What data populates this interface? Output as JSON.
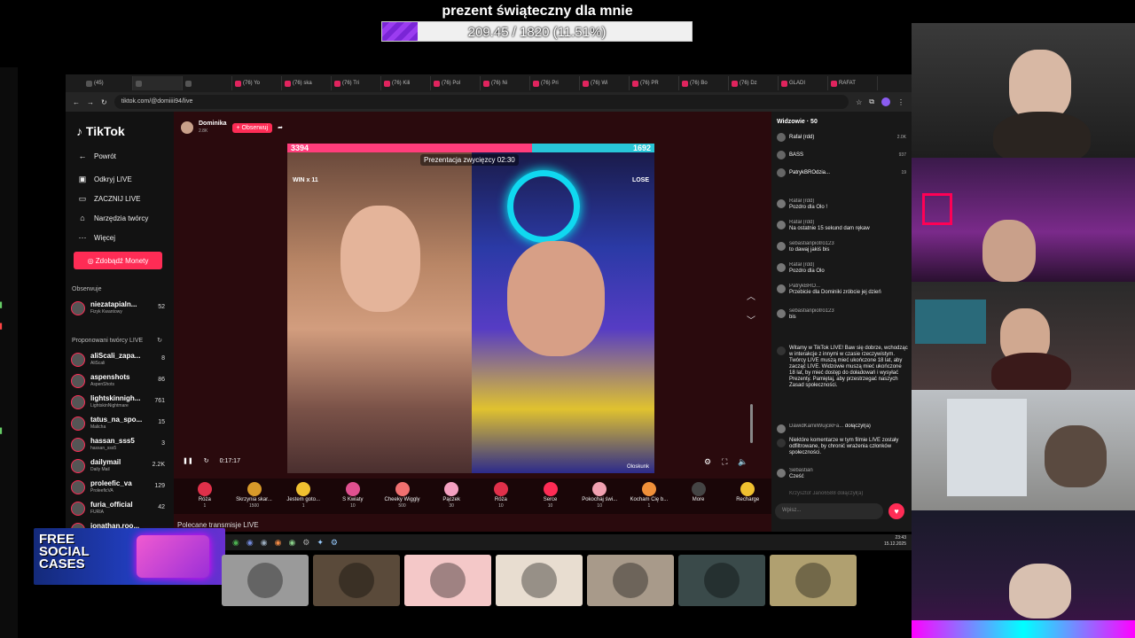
{
  "goal": {
    "title": "prezent świąteczny dla mnie",
    "progress_text": "209.45 / 1820 (11.51%)",
    "fraction": 0.1151
  },
  "browser": {
    "tabs": [
      "(45)",
      "",
      "",
      "(76) Yo",
      "(76) ska",
      "(76) Tri",
      "(76) Kili",
      "(76) Pol",
      "(76) Ni",
      "(76) Pri",
      "(76) Wi",
      "(76) PR",
      "(76) Bo",
      "(76) Dz",
      "GLADI",
      "RAFAT"
    ],
    "url": "tiktok.com/@domiiii94/live"
  },
  "tiktok": {
    "logo": "TikTok",
    "nav": [
      "Powrót",
      "Odkryj LIVE",
      "ZACZNIJ LIVE",
      "Narzędzia twórcy",
      "Więcej"
    ],
    "nav_icons": [
      "arrow-left",
      "broadcast",
      "camera",
      "tools",
      "ellipsis"
    ],
    "coins_button": "Zdobądź Monety",
    "following_header": "Obserwuje",
    "following": [
      {
        "name": "niezatapialn...",
        "sub": "Fizyk Kwantowy",
        "count": "52"
      }
    ],
    "suggested_header": "Proponowani twórcy LIVE",
    "suggested": [
      {
        "name": "aliScali_zapa...",
        "sub": "AliScali",
        "count": "8"
      },
      {
        "name": "aspenshots",
        "sub": "AspenShots",
        "count": "86"
      },
      {
        "name": "lightskinnigh...",
        "sub": "LightskinNightmare",
        "count": "761"
      },
      {
        "name": "tatus_na_spo...",
        "sub": "Malicha",
        "count": "15"
      },
      {
        "name": "hassan_sss5",
        "sub": "hassan_sss5",
        "count": "3"
      },
      {
        "name": "dailymail",
        "sub": "Daily Mail",
        "count": "2.2K"
      },
      {
        "name": "proleefic_va",
        "sub": "ProleeficVA",
        "count": "129"
      },
      {
        "name": "furia_official",
        "sub": "FURIA",
        "count": "42"
      },
      {
        "name": "jonathan.roo...",
        "sub": "",
        "count": ""
      }
    ]
  },
  "stage": {
    "host_name": "Dominika",
    "host_likes": "2.8K",
    "follow_button": "+ Obserwuj",
    "score_left": "3394",
    "score_right": "1692",
    "score_left_fraction": 0.667,
    "round_label": "Prezentacja zwycięzcy 02:30",
    "win_label": "WIN x 11",
    "lose_label": "LOSE",
    "right_name": "Oloskunk",
    "time": "0:17:17",
    "more_lives": "Polecane transmisje LIVE"
  },
  "gifts": [
    {
      "name": "Róża",
      "price": "1",
      "color": "#e0304a"
    },
    {
      "name": "Skrzynia skar...",
      "price": "1500",
      "color": "#d89a2a"
    },
    {
      "name": "Jestem goto...",
      "price": "1",
      "color": "#f0c030"
    },
    {
      "name": "S Kwiaty",
      "price": "10",
      "color": "#e05090"
    },
    {
      "name": "Cheeky Wiggly",
      "price": "500",
      "color": "#f07070"
    },
    {
      "name": "Pączek",
      "price": "30",
      "color": "#f4a0c0"
    },
    {
      "name": "Róża",
      "price": "10",
      "color": "#e0304a"
    },
    {
      "name": "Serce",
      "price": "10",
      "color": "#fe2c55"
    },
    {
      "name": "Pokochaj świ...",
      "price": "10",
      "color": "#f0a0b0"
    },
    {
      "name": "Kocham Cię b...",
      "price": "1",
      "color": "#f0903a"
    },
    {
      "name": "More",
      "price": "",
      "color": "#444"
    },
    {
      "name": "Recharge",
      "price": "",
      "color": "#f0c030"
    }
  ],
  "chat": {
    "viewers_header": "Widzowie · 50",
    "viewers": [
      {
        "name": "Rafał (rdd)",
        "count": "2.0K"
      },
      {
        "name": "BASS",
        "count": "937"
      },
      {
        "name": "PatrykBROdzia...",
        "count": "19"
      }
    ],
    "messages": [
      {
        "user": "Rafał (rdd)",
        "text": "Pozdro dla Olo !"
      },
      {
        "user": "Rafał (rdd)",
        "text": "Na ostatnie 15 sekund dam rękaw"
      },
      {
        "user": "sebastianpiotro123",
        "text": "to dawaj jakiś bis"
      },
      {
        "user": "Rafał (rdd)",
        "text": "Pozdro dla Olo"
      },
      {
        "user": "PatrykBRO...",
        "text": "Przebicie dla Dominiki zróbcie jej dzień"
      },
      {
        "user": "sebastianpiotro123",
        "text": "bis"
      }
    ],
    "notice": "Witamy w TikTok LIVE! Baw się dobrze, wchodząc w interakcje z innymi w czasie rzeczywistym. Twórcy LIVE muszą mieć ukończone 18 lat, aby zacząć LIVE. Widzowie muszą mieć ukończone 18 lat, by mieć dostęp do doładowań i wysyłać Prezenty. Pamiętaj, aby przestrzegać naszych Zasad społeczności.",
    "joined": {
      "user": "DawidKamilWujcikFa...",
      "text": "dołączył(a)"
    },
    "filter_notice": "Niektóre komentarze w tym filmie LIVE zostały odfiltrowane, by chronić wrażenia członków społeczności.",
    "last": {
      "user": "Sebastian",
      "text": "Cześć"
    },
    "joined2": {
      "user": "Krzysztof Jano6588",
      "text": "dołączył(a)"
    },
    "input_placeholder": "Wpisz..."
  },
  "taskbar": {
    "time": "23:43",
    "date": "15.12.2025"
  },
  "ad": {
    "line1": "FREE",
    "line2": "SOCIAL",
    "line3": "CASES"
  },
  "thumb_colors": [
    "#9a9a9a",
    "#5a4a3a",
    "#f4c8c8",
    "#e8ddd0",
    "#a89a8a",
    "#3a4a4a",
    "#b0a070"
  ]
}
